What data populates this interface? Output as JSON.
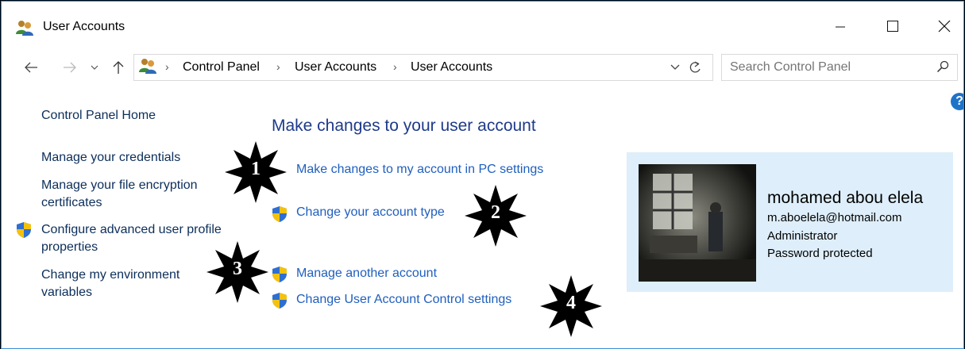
{
  "window": {
    "title": "User Accounts",
    "minimize_icon": "minimize-icon",
    "maximize_icon": "maximize-icon",
    "close_icon": "close-icon"
  },
  "address_bar": {
    "breadcrumbs": [
      "Control Panel",
      "User Accounts",
      "User Accounts"
    ],
    "refresh_icon": "refresh-icon"
  },
  "search": {
    "placeholder": "Search Control Panel",
    "icon": "search-icon"
  },
  "sidebar": {
    "home": "Control Panel Home",
    "links": [
      "Manage your credentials",
      "Manage your file encryption certificates",
      "Configure advanced user profile properties",
      "Change my environment variables"
    ]
  },
  "main": {
    "title": "Make changes to your user account",
    "tasks": [
      "Make changes to my account in PC settings",
      "Change your account type",
      "Manage another account",
      "Change User Account Control settings"
    ]
  },
  "user": {
    "name": "mohamed abou elela",
    "email": "m.aboelela@hotmail.com",
    "role": "Administrator",
    "status": "Password protected"
  },
  "annotations": [
    "1",
    "2",
    "3",
    "4"
  ],
  "colors": {
    "link": "#1f5fbf",
    "title": "#1e3a8a",
    "panel": "#deeefa",
    "window_border": "#3a8fd8",
    "help": "#1e73c9"
  }
}
